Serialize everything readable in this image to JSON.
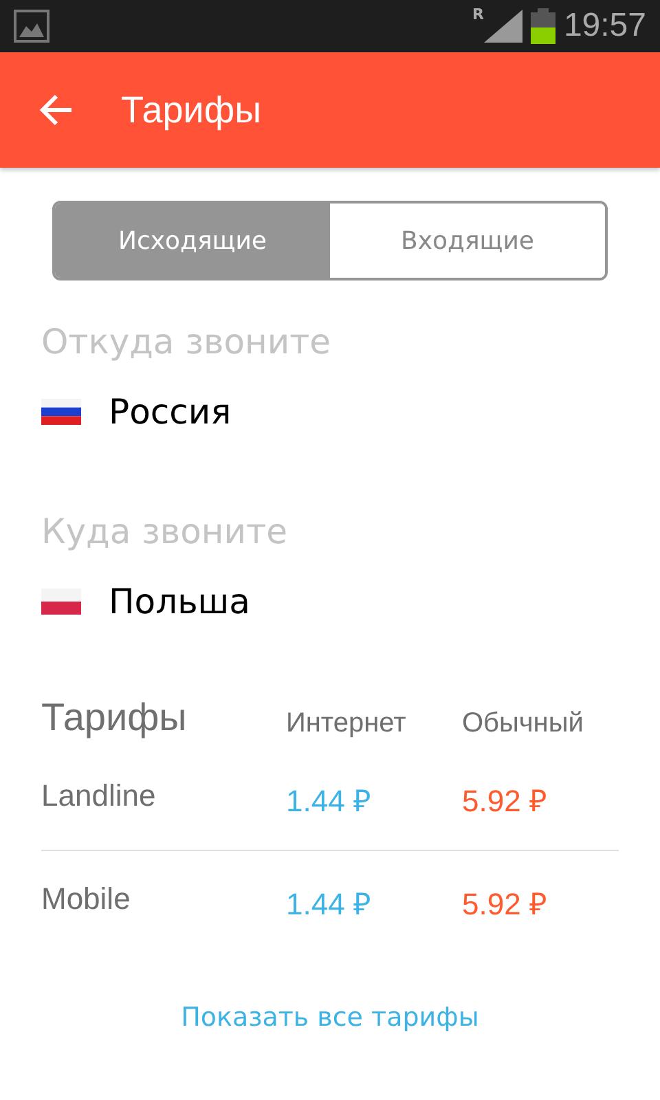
{
  "status_bar": {
    "roaming": "R",
    "time": "19:57"
  },
  "app_bar": {
    "title": "Тарифы"
  },
  "tabs": [
    {
      "label": "Исходящие",
      "selected": true
    },
    {
      "label": "Входящие",
      "selected": false
    }
  ],
  "from": {
    "label": "Откуда звоните",
    "country": "Россия",
    "kind": "tricolor"
  },
  "to": {
    "label": "Куда звоните",
    "country": "Польша",
    "kind": "bicolor"
  },
  "rates": {
    "title": "Тарифы",
    "columns": [
      "Интернет",
      "Обычный"
    ],
    "rows": [
      {
        "name": "Landline",
        "internet": "1.44 ₽",
        "regular": "5.92 ₽"
      },
      {
        "name": "Mobile",
        "internet": "1.44 ₽",
        "regular": "5.92 ₽"
      }
    ]
  },
  "show_all_link": "Показать все тарифы"
}
